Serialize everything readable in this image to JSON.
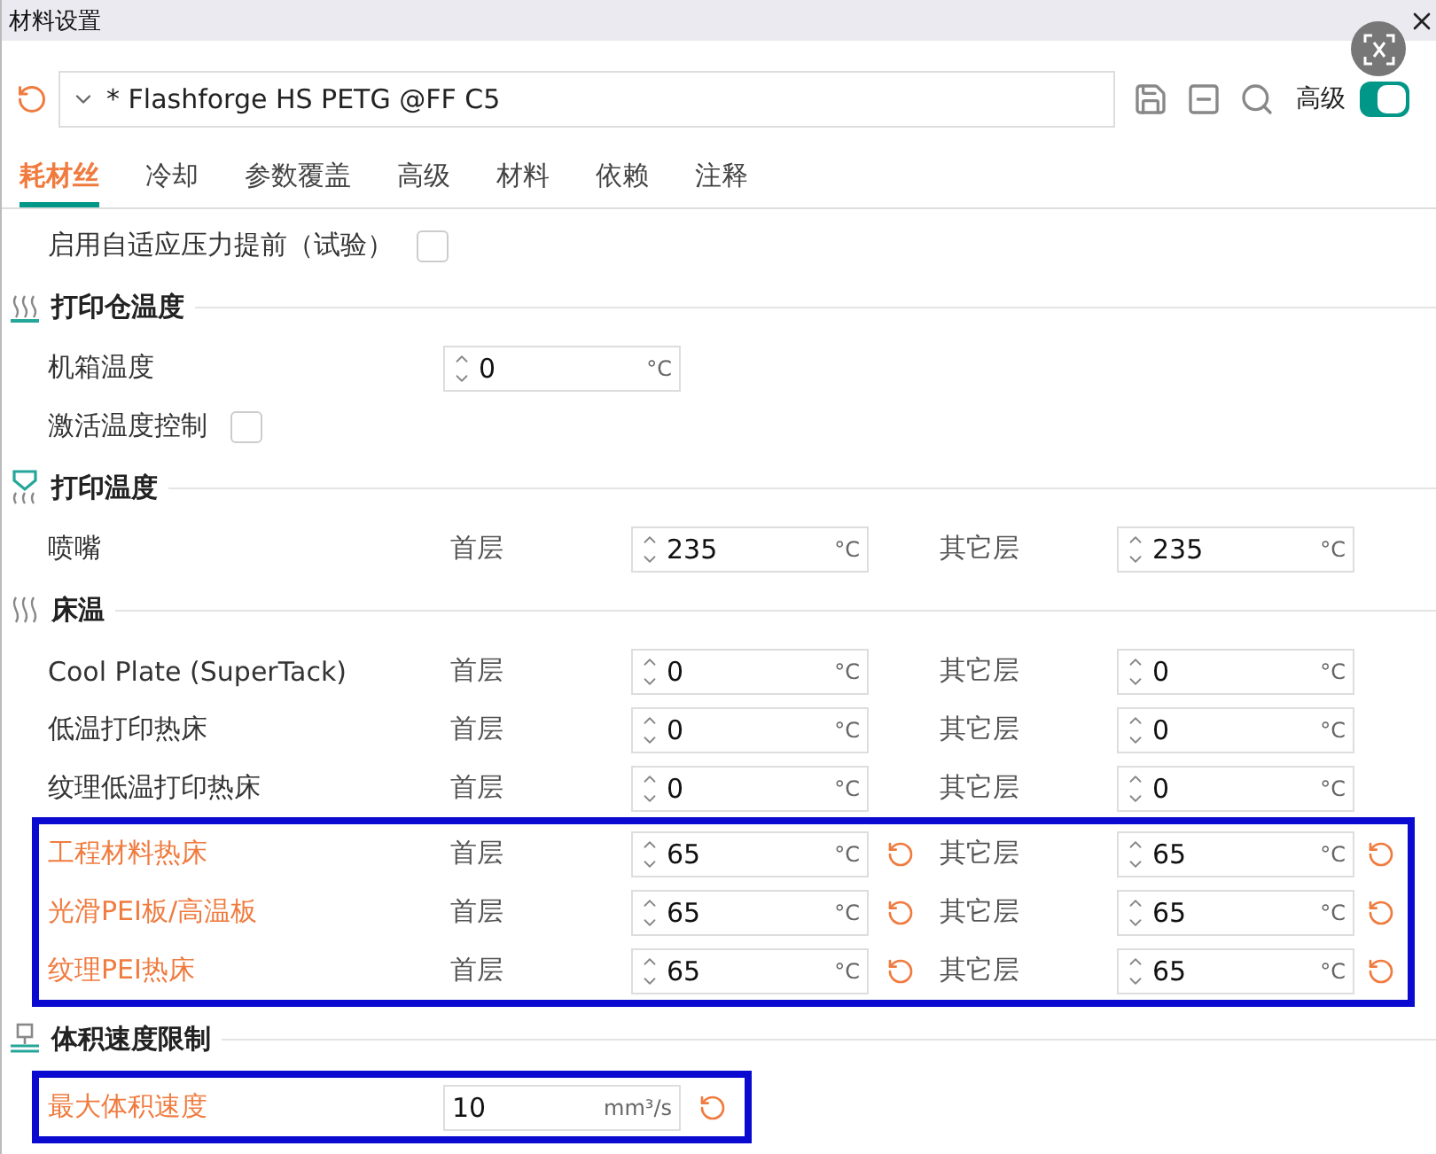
{
  "window": {
    "title": "材料设置"
  },
  "preset": {
    "name": "* Flashforge HS PETG @FF C5"
  },
  "advanced": {
    "label": "高级",
    "on": true
  },
  "tabs": [
    {
      "label": "耗材丝",
      "selected": true
    },
    {
      "label": "冷却",
      "selected": false
    },
    {
      "label": "参数覆盖",
      "selected": false
    },
    {
      "label": "高级",
      "selected": false
    },
    {
      "label": "材料",
      "selected": false
    },
    {
      "label": "依赖",
      "selected": false
    },
    {
      "label": "注释",
      "selected": false
    }
  ],
  "rows": [
    {
      "kind": "checkbox",
      "label": "启用自适应压力提前（试验）",
      "checked": false
    },
    {
      "kind": "heading",
      "label": "打印仓温度"
    },
    {
      "kind": "single",
      "label": "机箱温度",
      "value": "0",
      "unit": "°C",
      "spinner": true,
      "modified": false
    },
    {
      "kind": "checkbox",
      "label": "激活温度控制",
      "checked": false
    },
    {
      "kind": "heading",
      "label": "打印温度"
    },
    {
      "kind": "dual",
      "label": "喷嘴",
      "first_label": "首层",
      "first": "235",
      "first_unit": "°C",
      "other_label": "其它层",
      "other": "235",
      "other_unit": "°C",
      "modified": false
    },
    {
      "kind": "heading",
      "label": "床温"
    },
    {
      "kind": "dual",
      "label": "Cool Plate (SuperTack)",
      "first_label": "首层",
      "first": "0",
      "first_unit": "°C",
      "other_label": "其它层",
      "other": "0",
      "other_unit": "°C",
      "modified": false
    },
    {
      "kind": "dual",
      "label": "低温打印热床",
      "first_label": "首层",
      "first": "0",
      "first_unit": "°C",
      "other_label": "其它层",
      "other": "0",
      "other_unit": "°C",
      "modified": false
    },
    {
      "kind": "dual",
      "label": "纹理低温打印热床",
      "first_label": "首层",
      "first": "0",
      "first_unit": "°C",
      "other_label": "其它层",
      "other": "0",
      "other_unit": "°C",
      "modified": false
    },
    {
      "kind": "frame",
      "rows": [
        {
          "kind": "dual",
          "label": "工程材料热床",
          "first_label": "首层",
          "first": "65",
          "first_unit": "°C",
          "other_label": "其它层",
          "other": "65",
          "other_unit": "°C",
          "modified": true
        },
        {
          "kind": "dual",
          "label": "光滑PEI板/高温板",
          "first_label": "首层",
          "first": "65",
          "first_unit": "°C",
          "other_label": "其它层",
          "other": "65",
          "other_unit": "°C",
          "modified": true
        },
        {
          "kind": "dual",
          "label": "纹理PEI热床",
          "first_label": "首层",
          "first": "65",
          "first_unit": "°C",
          "other_label": "其它层",
          "other": "65",
          "other_unit": "°C",
          "modified": true
        }
      ]
    },
    {
      "kind": "heading",
      "label": "体积速度限制"
    },
    {
      "kind": "frame",
      "rows": [
        {
          "kind": "single",
          "label": "最大体积速度",
          "value": "10",
          "unit": "mm³/s",
          "spinner": false,
          "modified": true
        }
      ]
    }
  ]
}
